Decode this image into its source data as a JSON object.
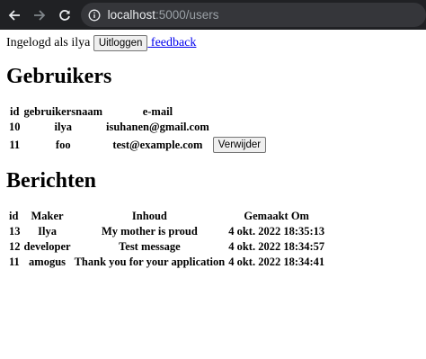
{
  "browser": {
    "url_host": "localhost",
    "url_path": ":5000/users"
  },
  "header": {
    "logged_in_text": "Ingelogd als ilya",
    "logout_label": "Uitloggen",
    "feedback_link": "feedback"
  },
  "users": {
    "title": "Gebruikers",
    "columns": [
      "id",
      "gebruikersnaam",
      "e-mail"
    ],
    "rows": [
      {
        "id": "10",
        "username": "ilya",
        "email": "isuhanen@gmail.com",
        "action": ""
      },
      {
        "id": "11",
        "username": "foo",
        "email": "test@example.com",
        "action": "Verwijder"
      }
    ]
  },
  "messages": {
    "title": "Berichten",
    "columns": [
      "id",
      "Maker",
      "Inhoud",
      "Gemaakt Om"
    ],
    "rows": [
      {
        "id": "13",
        "maker": "Ilya",
        "content": "My mother is proud",
        "created": "4 okt. 2022 18:35:13"
      },
      {
        "id": "12",
        "maker": "developer",
        "content": "Test message",
        "created": "4 okt. 2022 18:34:57"
      },
      {
        "id": "11",
        "maker": "amogus",
        "content": "Thank you for your application",
        "created": "4 okt. 2022 18:34:41"
      }
    ]
  }
}
